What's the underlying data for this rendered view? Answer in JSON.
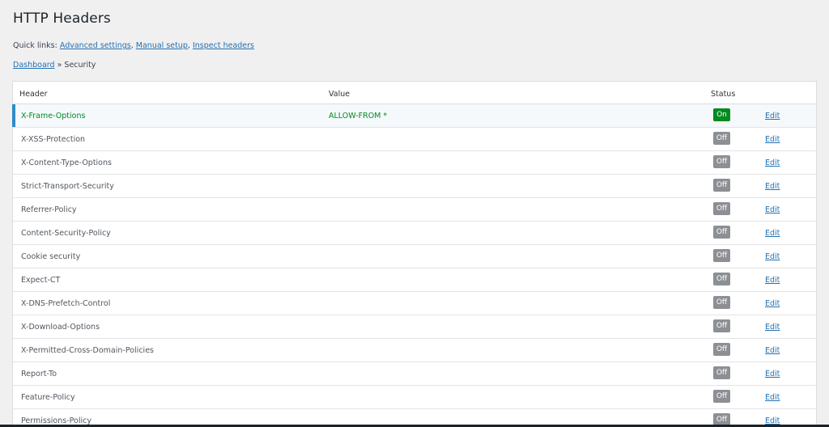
{
  "page": {
    "title": "HTTP Headers"
  },
  "quick_links": {
    "label": "Quick links:",
    "links": [
      "Advanced settings",
      "Manual setup",
      "Inspect headers"
    ]
  },
  "breadcrumb": {
    "home": "Dashboard",
    "separator": "»",
    "current": "Security"
  },
  "table": {
    "columns": {
      "header": "Header",
      "value": "Value",
      "status": "Status"
    },
    "edit_label": "Edit",
    "rows": [
      {
        "header": "X-Frame-Options",
        "value": "ALLOW-FROM *",
        "status": "On"
      },
      {
        "header": "X-XSS-Protection",
        "value": "",
        "status": "Off"
      },
      {
        "header": "X-Content-Type-Options",
        "value": "",
        "status": "Off"
      },
      {
        "header": "Strict-Transport-Security",
        "value": "",
        "status": "Off"
      },
      {
        "header": "Referrer-Policy",
        "value": "",
        "status": "Off"
      },
      {
        "header": "Content-Security-Policy",
        "value": "",
        "status": "Off"
      },
      {
        "header": "Cookie security",
        "value": "",
        "status": "Off"
      },
      {
        "header": "Expect-CT",
        "value": "",
        "status": "Off"
      },
      {
        "header": "X-DNS-Prefetch-Control",
        "value": "",
        "status": "Off"
      },
      {
        "header": "X-Download-Options",
        "value": "",
        "status": "Off"
      },
      {
        "header": "X-Permitted-Cross-Domain-Policies",
        "value": "",
        "status": "Off"
      },
      {
        "header": "Report-To",
        "value": "",
        "status": "Off"
      },
      {
        "header": "Feature-Policy",
        "value": "",
        "status": "Off"
      },
      {
        "header": "Permissions-Policy",
        "value": "",
        "status": "Off"
      }
    ]
  },
  "colors": {
    "on": "#008a20",
    "off": "#8c8f94",
    "link": "#2271b1",
    "active_marker": "#2e8bc9"
  }
}
